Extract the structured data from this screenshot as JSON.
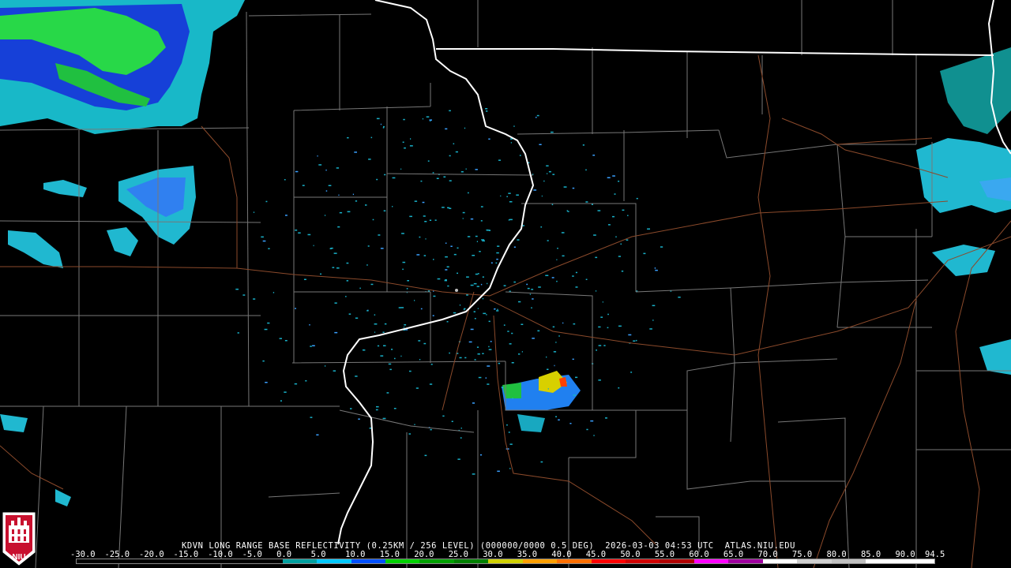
{
  "caption": {
    "radar": "KDVN LONG RANGE BASE REFLECTIVITY (0.25KM / 256 LEVEL) (000000/0000 0.5 DEG)",
    "timestamp": "2026-03-03 04:53 UTC",
    "source": "ATLAS.NIU.EDU"
  },
  "logo": {
    "text": "NIU",
    "icon": "niu-shield-icon",
    "color": "#c8102e"
  },
  "scale": {
    "labels": [
      "-30.0",
      "-25.0",
      "-20.0",
      "-15.0",
      "-10.0",
      "-5.0",
      "0.0",
      "5.0",
      "10.0",
      "15.0",
      "20.0",
      "25.0",
      "30.0",
      "35.0",
      "40.0",
      "45.0",
      "50.0",
      "55.0",
      "60.0",
      "65.0",
      "70.0",
      "75.0",
      "80.0",
      "85.0",
      "90.0",
      "94.5"
    ],
    "colors": [
      "#000000",
      "#000000",
      "#000000",
      "#000000",
      "#000000",
      "#000000",
      "#00a0a0",
      "#00c8ff",
      "#0050ff",
      "#00d000",
      "#00a000",
      "#008000",
      "#d0d000",
      "#ffa000",
      "#ff7000",
      "#ff0000",
      "#d00000",
      "#b00000",
      "#ff00ff",
      "#a000a0",
      "#ffffff",
      "#d0d0d0",
      "#c0c0c0",
      "#ffffff",
      "#ffffff"
    ]
  },
  "colors": {
    "background": "#000000",
    "county_lines": "#777777",
    "state_lines": "#ffffff",
    "roads": "#8b4a2b"
  }
}
